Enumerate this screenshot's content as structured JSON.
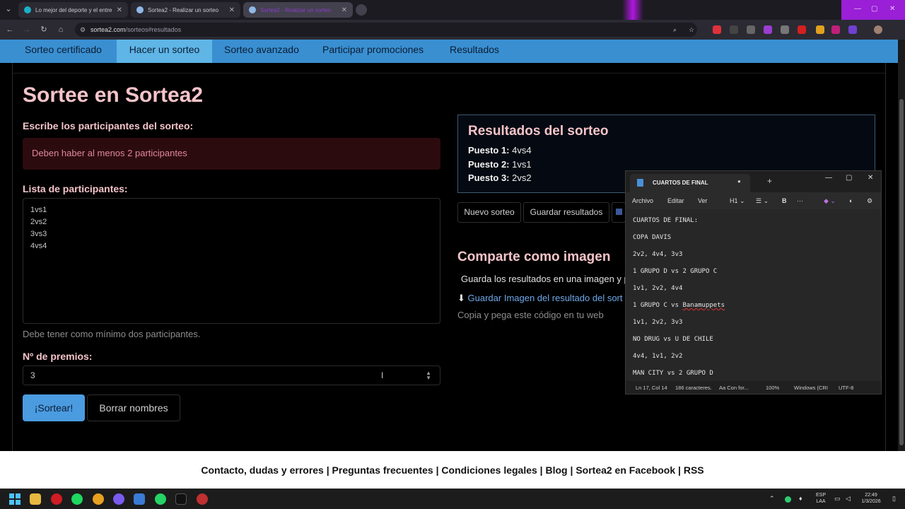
{
  "browser": {
    "tabs": [
      {
        "title": "Lo mejor del deporte y el entre",
        "active": false
      },
      {
        "title": "Sortea2 - Realizar un sorteo",
        "active": false
      },
      {
        "title": "Sortea2 - Realizar un sorteo",
        "active": true
      }
    ],
    "url_domain": "sortea2.com",
    "url_path": "/sorteos#resultados"
  },
  "nav": {
    "items": [
      "Sorteo certificado",
      "Hacer un sorteo",
      "Sorteo avanzado",
      "Participar promociones",
      "Resultados"
    ],
    "active_index": 1
  },
  "main": {
    "title": "Sortee en Sortea2",
    "write_label": "Escribe los participantes del sorteo:",
    "alert": "Deben haber al menos 2 participantes",
    "list_label": "Lista de participantes:",
    "participants": [
      "1vs1",
      "2vs2",
      "3vs3",
      "4vs4"
    ],
    "hint": "Debe tener como mínimo dos participantes.",
    "prizes_label": "Nº de premios:",
    "prizes_value": "3",
    "draw_button": "¡Sortear!",
    "clear_button": "Borrar nombres"
  },
  "results": {
    "title": "Resultados del sorteo",
    "places": [
      {
        "label": "Puesto 1:",
        "value": "4vs4"
      },
      {
        "label": "Puesto 2:",
        "value": "1vs1"
      },
      {
        "label": "Puesto 3:",
        "value": "2vs2"
      }
    ],
    "new_button": "Nuevo sorteo",
    "save_button": "Guardar resultados"
  },
  "share": {
    "title": "Comparte como imagen",
    "description": "Guarda los resultados en una imagen y p",
    "link": "Guardar Imagen del resultado del sort",
    "code_text": "Copia y pega este código en tu web"
  },
  "footer": {
    "links": [
      "Contacto, dudas y errores",
      "Preguntas frecuentes",
      "Condiciones legales",
      "Blog",
      "Sortea2 en Facebook",
      "RSS"
    ]
  },
  "notepad": {
    "tab_title": "CUARTOS DE FINAL",
    "menu": [
      "Archivo",
      "Editar",
      "Ver"
    ],
    "heading_select": "H1",
    "bold_label": "B",
    "lines": [
      "CUARTOS DE FINAL:",
      "COPA DAVIS",
      "2v2, 4v4, 3v3",
      "1 GRUPO D vs 2 GRUPO C",
      "1v1, 2v2, 4v4",
      "1 GRUPO C vs Banamuppets",
      "1v1, 2v2, 3v3",
      "NO DRUG vs U DE CHILE",
      "4v4, 1v1, 2v2",
      "MAN CITY vs 2 GRUPO D"
    ],
    "status": {
      "position": "Ln 17, Col 14",
      "chars": "186 caracteres.",
      "format": "Con for...",
      "zoom": "100%",
      "line_ending": "Windows (CRI",
      "encoding": "UTF-8"
    }
  },
  "taskbar": {
    "lang_top": "ESP",
    "lang_bottom": "LAA",
    "time": "22:49",
    "date": "1/3/2026"
  }
}
